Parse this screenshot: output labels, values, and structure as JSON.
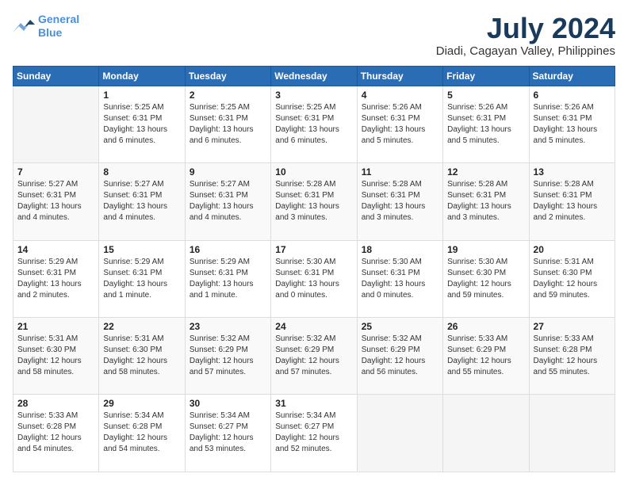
{
  "logo": {
    "line1": "General",
    "line2": "Blue"
  },
  "header": {
    "month": "July 2024",
    "location": "Diadi, Cagayan Valley, Philippines"
  },
  "weekdays": [
    "Sunday",
    "Monday",
    "Tuesday",
    "Wednesday",
    "Thursday",
    "Friday",
    "Saturday"
  ],
  "weeks": [
    [
      {
        "day": "",
        "sunrise": "",
        "sunset": "",
        "daylight": ""
      },
      {
        "day": "1",
        "sunrise": "Sunrise: 5:25 AM",
        "sunset": "Sunset: 6:31 PM",
        "daylight": "Daylight: 13 hours and 6 minutes."
      },
      {
        "day": "2",
        "sunrise": "Sunrise: 5:25 AM",
        "sunset": "Sunset: 6:31 PM",
        "daylight": "Daylight: 13 hours and 6 minutes."
      },
      {
        "day": "3",
        "sunrise": "Sunrise: 5:25 AM",
        "sunset": "Sunset: 6:31 PM",
        "daylight": "Daylight: 13 hours and 6 minutes."
      },
      {
        "day": "4",
        "sunrise": "Sunrise: 5:26 AM",
        "sunset": "Sunset: 6:31 PM",
        "daylight": "Daylight: 13 hours and 5 minutes."
      },
      {
        "day": "5",
        "sunrise": "Sunrise: 5:26 AM",
        "sunset": "Sunset: 6:31 PM",
        "daylight": "Daylight: 13 hours and 5 minutes."
      },
      {
        "day": "6",
        "sunrise": "Sunrise: 5:26 AM",
        "sunset": "Sunset: 6:31 PM",
        "daylight": "Daylight: 13 hours and 5 minutes."
      }
    ],
    [
      {
        "day": "7",
        "sunrise": "Sunrise: 5:27 AM",
        "sunset": "Sunset: 6:31 PM",
        "daylight": "Daylight: 13 hours and 4 minutes."
      },
      {
        "day": "8",
        "sunrise": "Sunrise: 5:27 AM",
        "sunset": "Sunset: 6:31 PM",
        "daylight": "Daylight: 13 hours and 4 minutes."
      },
      {
        "day": "9",
        "sunrise": "Sunrise: 5:27 AM",
        "sunset": "Sunset: 6:31 PM",
        "daylight": "Daylight: 13 hours and 4 minutes."
      },
      {
        "day": "10",
        "sunrise": "Sunrise: 5:28 AM",
        "sunset": "Sunset: 6:31 PM",
        "daylight": "Daylight: 13 hours and 3 minutes."
      },
      {
        "day": "11",
        "sunrise": "Sunrise: 5:28 AM",
        "sunset": "Sunset: 6:31 PM",
        "daylight": "Daylight: 13 hours and 3 minutes."
      },
      {
        "day": "12",
        "sunrise": "Sunrise: 5:28 AM",
        "sunset": "Sunset: 6:31 PM",
        "daylight": "Daylight: 13 hours and 3 minutes."
      },
      {
        "day": "13",
        "sunrise": "Sunrise: 5:28 AM",
        "sunset": "Sunset: 6:31 PM",
        "daylight": "Daylight: 13 hours and 2 minutes."
      }
    ],
    [
      {
        "day": "14",
        "sunrise": "Sunrise: 5:29 AM",
        "sunset": "Sunset: 6:31 PM",
        "daylight": "Daylight: 13 hours and 2 minutes."
      },
      {
        "day": "15",
        "sunrise": "Sunrise: 5:29 AM",
        "sunset": "Sunset: 6:31 PM",
        "daylight": "Daylight: 13 hours and 1 minute."
      },
      {
        "day": "16",
        "sunrise": "Sunrise: 5:29 AM",
        "sunset": "Sunset: 6:31 PM",
        "daylight": "Daylight: 13 hours and 1 minute."
      },
      {
        "day": "17",
        "sunrise": "Sunrise: 5:30 AM",
        "sunset": "Sunset: 6:31 PM",
        "daylight": "Daylight: 13 hours and 0 minutes."
      },
      {
        "day": "18",
        "sunrise": "Sunrise: 5:30 AM",
        "sunset": "Sunset: 6:31 PM",
        "daylight": "Daylight: 13 hours and 0 minutes."
      },
      {
        "day": "19",
        "sunrise": "Sunrise: 5:30 AM",
        "sunset": "Sunset: 6:30 PM",
        "daylight": "Daylight: 12 hours and 59 minutes."
      },
      {
        "day": "20",
        "sunrise": "Sunrise: 5:31 AM",
        "sunset": "Sunset: 6:30 PM",
        "daylight": "Daylight: 12 hours and 59 minutes."
      }
    ],
    [
      {
        "day": "21",
        "sunrise": "Sunrise: 5:31 AM",
        "sunset": "Sunset: 6:30 PM",
        "daylight": "Daylight: 12 hours and 58 minutes."
      },
      {
        "day": "22",
        "sunrise": "Sunrise: 5:31 AM",
        "sunset": "Sunset: 6:30 PM",
        "daylight": "Daylight: 12 hours and 58 minutes."
      },
      {
        "day": "23",
        "sunrise": "Sunrise: 5:32 AM",
        "sunset": "Sunset: 6:29 PM",
        "daylight": "Daylight: 12 hours and 57 minutes."
      },
      {
        "day": "24",
        "sunrise": "Sunrise: 5:32 AM",
        "sunset": "Sunset: 6:29 PM",
        "daylight": "Daylight: 12 hours and 57 minutes."
      },
      {
        "day": "25",
        "sunrise": "Sunrise: 5:32 AM",
        "sunset": "Sunset: 6:29 PM",
        "daylight": "Daylight: 12 hours and 56 minutes."
      },
      {
        "day": "26",
        "sunrise": "Sunrise: 5:33 AM",
        "sunset": "Sunset: 6:29 PM",
        "daylight": "Daylight: 12 hours and 55 minutes."
      },
      {
        "day": "27",
        "sunrise": "Sunrise: 5:33 AM",
        "sunset": "Sunset: 6:28 PM",
        "daylight": "Daylight: 12 hours and 55 minutes."
      }
    ],
    [
      {
        "day": "28",
        "sunrise": "Sunrise: 5:33 AM",
        "sunset": "Sunset: 6:28 PM",
        "daylight": "Daylight: 12 hours and 54 minutes."
      },
      {
        "day": "29",
        "sunrise": "Sunrise: 5:34 AM",
        "sunset": "Sunset: 6:28 PM",
        "daylight": "Daylight: 12 hours and 54 minutes."
      },
      {
        "day": "30",
        "sunrise": "Sunrise: 5:34 AM",
        "sunset": "Sunset: 6:27 PM",
        "daylight": "Daylight: 12 hours and 53 minutes."
      },
      {
        "day": "31",
        "sunrise": "Sunrise: 5:34 AM",
        "sunset": "Sunset: 6:27 PM",
        "daylight": "Daylight: 12 hours and 52 minutes."
      },
      {
        "day": "",
        "sunrise": "",
        "sunset": "",
        "daylight": ""
      },
      {
        "day": "",
        "sunrise": "",
        "sunset": "",
        "daylight": ""
      },
      {
        "day": "",
        "sunrise": "",
        "sunset": "",
        "daylight": ""
      }
    ]
  ]
}
